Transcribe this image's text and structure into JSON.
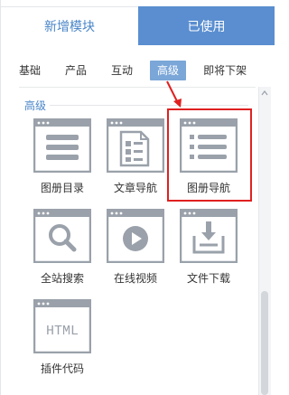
{
  "top_tabs": [
    "新增模块",
    "已使用"
  ],
  "sub_tabs": [
    "基础",
    "产品",
    "互动",
    "高级",
    "即将下架"
  ],
  "active_sub_tab": "高级",
  "section_title": "高级",
  "modules": [
    {
      "label": "图册目录",
      "icon": "photo-catalog-icon"
    },
    {
      "label": "文章导航",
      "icon": "article-nav-icon"
    },
    {
      "label": "图册导航",
      "icon": "photo-nav-icon"
    },
    {
      "label": "全站搜索",
      "icon": "search-icon"
    },
    {
      "label": "在线视频",
      "icon": "play-video-icon"
    },
    {
      "label": "文件下载",
      "icon": "download-icon"
    },
    {
      "label": "插件代码",
      "icon": "html-code-icon"
    }
  ],
  "html_icon_text": "HTML",
  "colors": {
    "accent": "#5a8ed0",
    "icon": "#9aa1aa",
    "highlight": "#e02020"
  }
}
